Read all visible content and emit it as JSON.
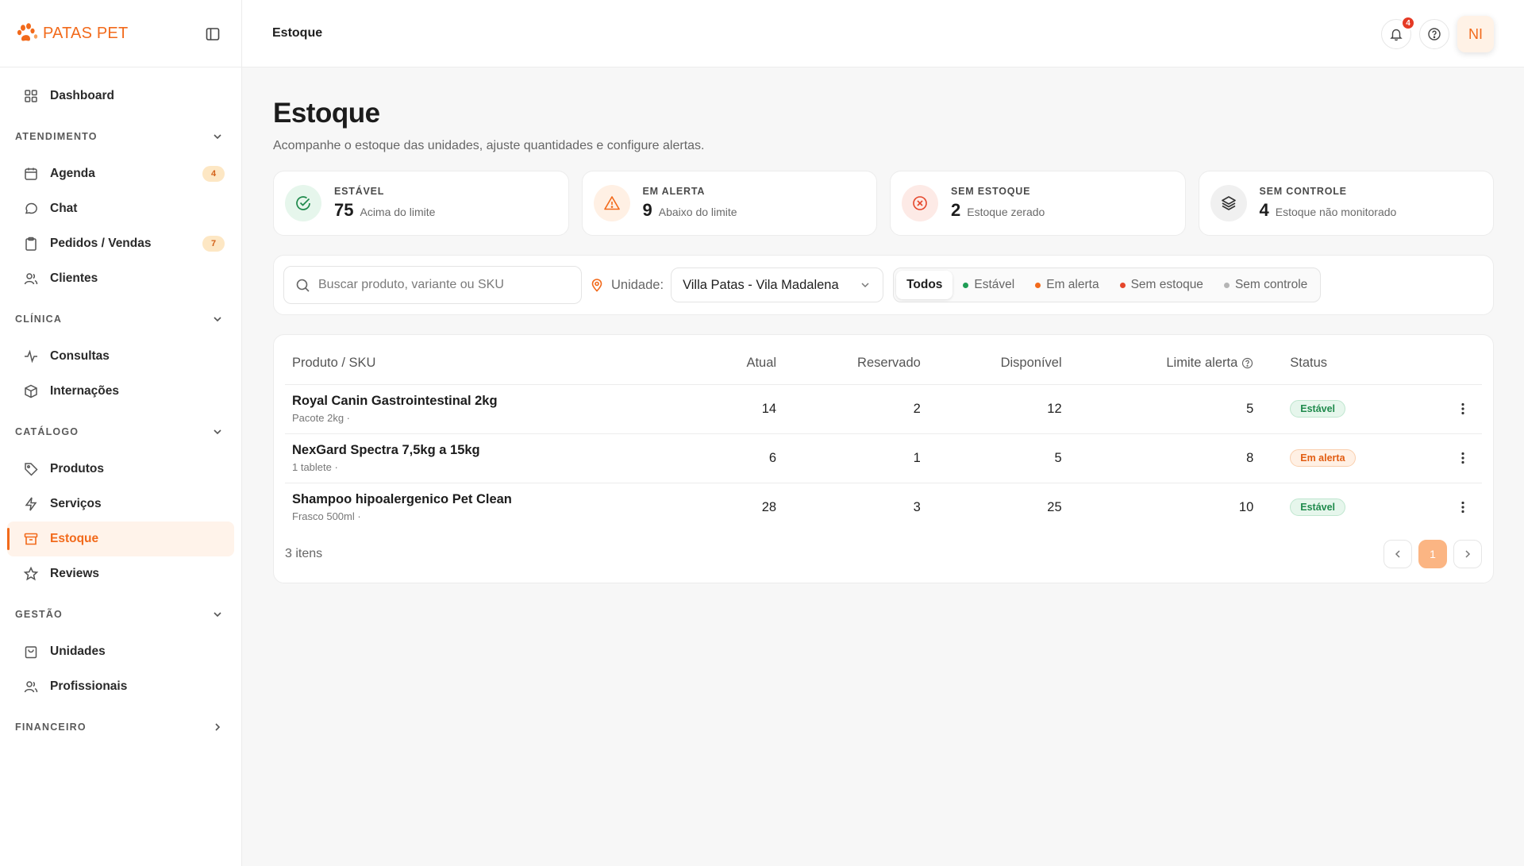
{
  "brand": {
    "name": "PATAS PET",
    "accent": "#f26a1b"
  },
  "sidebar": {
    "dashboard": "Dashboard",
    "groups": {
      "atendimento": "ATENDIMENTO",
      "clinica": "CLÍNICA",
      "catalogo": "CATÁLOGO",
      "gestao": "GESTÃO",
      "financeiro": "FINANCEIRO"
    },
    "items": {
      "agenda": {
        "label": "Agenda",
        "badge": "4"
      },
      "chat": {
        "label": "Chat"
      },
      "pedidos": {
        "label": "Pedidos / Vendas",
        "badge": "7"
      },
      "clientes": {
        "label": "Clientes"
      },
      "consultas": {
        "label": "Consultas"
      },
      "internacoes": {
        "label": "Internações"
      },
      "produtos": {
        "label": "Produtos"
      },
      "servicos": {
        "label": "Serviços"
      },
      "estoque": {
        "label": "Estoque"
      },
      "reviews": {
        "label": "Reviews"
      },
      "unidades": {
        "label": "Unidades"
      },
      "profissionais": {
        "label": "Profissionais"
      }
    }
  },
  "header": {
    "breadcrumb": "Estoque",
    "notifications": "4",
    "avatar_initials": "NI"
  },
  "page": {
    "title": "Estoque",
    "subtitle": "Acompanhe o estoque das unidades, ajuste quantidades e configure alertas."
  },
  "stats": [
    {
      "title": "ESTÁVEL",
      "value": "75",
      "desc": "Acima do limite",
      "icon": "check-circle-icon",
      "color": "#1f8a4c",
      "bg": "#e6f6ec"
    },
    {
      "title": "EM ALERTA",
      "value": "9",
      "desc": "Abaixo do limite",
      "icon": "warning-triangle-icon",
      "color": "#f26a1b",
      "bg": "#fff0e4"
    },
    {
      "title": "SEM ESTOQUE",
      "value": "2",
      "desc": "Estoque zerado",
      "icon": "x-circle-icon",
      "color": "#e5462b",
      "bg": "#fdeae6"
    },
    {
      "title": "SEM CONTROLE",
      "value": "4",
      "desc": "Estoque não monitorado",
      "icon": "layers-icon",
      "color": "#333333",
      "bg": "#f0f0f0"
    }
  ],
  "filters": {
    "search_placeholder": "Buscar produto, variante ou SKU",
    "search_value": "",
    "unit_label": "Unidade:",
    "unit_value": "Villa Patas - Vila Madalena",
    "segments": [
      {
        "label": "Todos",
        "active": true,
        "dot": ""
      },
      {
        "label": "Estável",
        "active": false,
        "dot": "#1f9d55"
      },
      {
        "label": "Em alerta",
        "active": false,
        "dot": "#f26a1b"
      },
      {
        "label": "Sem estoque",
        "active": false,
        "dot": "#e5462b"
      },
      {
        "label": "Sem controle",
        "active": false,
        "dot": "#b5b5b5"
      }
    ]
  },
  "table": {
    "headers": {
      "product": "Produto / SKU",
      "current": "Atual",
      "reserved": "Reservado",
      "available": "Disponível",
      "limit": "Limite alerta",
      "status": "Status"
    },
    "rows": [
      {
        "name": "Royal Canin Gastrointestinal 2kg",
        "sku": "Pacote 2kg ·",
        "current": "14",
        "reserved": "2",
        "available": "12",
        "limit": "5",
        "status": "Estável",
        "status_kind": "ok"
      },
      {
        "name": "NexGard Spectra 7,5kg a 15kg",
        "sku": "1 tablete ·",
        "current": "6",
        "reserved": "1",
        "available": "5",
        "limit": "8",
        "status": "Em alerta",
        "status_kind": "warn"
      },
      {
        "name": "Shampoo hipoalergenico Pet Clean",
        "sku": "Frasco 500ml ·",
        "current": "28",
        "reserved": "3",
        "available": "25",
        "limit": "10",
        "status": "Estável",
        "status_kind": "ok"
      }
    ],
    "count_label": "3 itens",
    "current_page": "1"
  }
}
